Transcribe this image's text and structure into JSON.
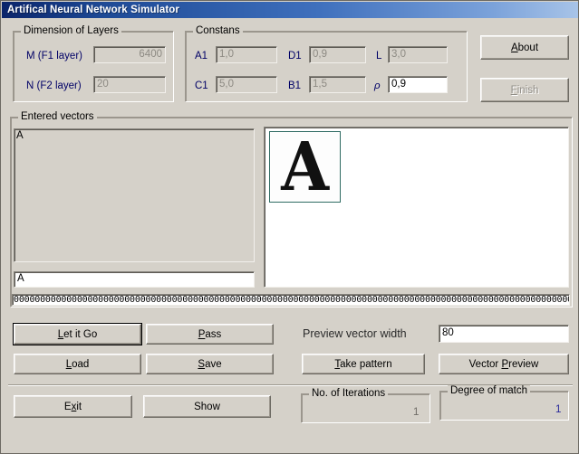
{
  "window": {
    "title": "Artifical Neural Network Simulator"
  },
  "dimension_group": {
    "title": "Dimension of Layers",
    "m_label": "M (F1 layer)",
    "m_value": "6400",
    "n_label": "N (F2 layer)",
    "n_value": "20"
  },
  "constants_group": {
    "title": "Constans",
    "a1_label": "A1",
    "a1_value": "1,0",
    "c1_label": "C1",
    "c1_value": "5,0",
    "d1_label": "D1",
    "d1_value": "0,9",
    "b1_label": "B1",
    "b1_value": "1,5",
    "l_label": "L",
    "l_value": "3,0",
    "rho_label": "ρ",
    "rho_value": "0,9"
  },
  "top_buttons": {
    "about": "About",
    "finish": "Finish"
  },
  "vectors_group": {
    "title": "Entered vectors",
    "list_items": [
      "A"
    ],
    "edit_value": "A",
    "vector_string": "00000000000000000000000000000000000000000000000000000000000000000000000000000000000000000000000000000000000000000000000000000000000000000000"
  },
  "preview": {
    "glyph": "A"
  },
  "action_buttons": {
    "let_it_go": "Let it Go",
    "pass": "Pass",
    "load": "Load",
    "save": "Save",
    "take_pattern": "Take pattern",
    "vector_preview": "Vector Preview",
    "exit": "Exit",
    "show": "Show"
  },
  "preview_width": {
    "label": "Preview vector width",
    "value": "80"
  },
  "iterations_group": {
    "title": "No. of Iterations",
    "value": "1"
  },
  "match_group": {
    "title": "Degree of match",
    "value": "1"
  }
}
